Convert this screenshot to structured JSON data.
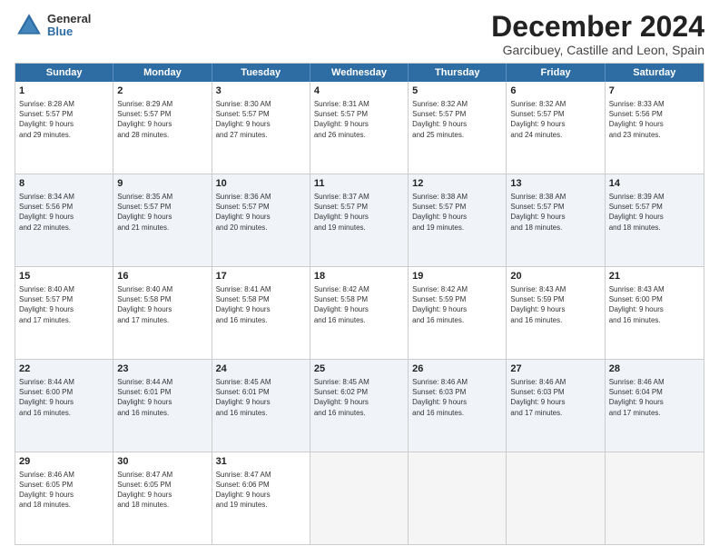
{
  "logo": {
    "general": "General",
    "blue": "Blue"
  },
  "title": {
    "month": "December 2024",
    "location": "Garcibuey, Castille and Leon, Spain"
  },
  "weekdays": [
    "Sunday",
    "Monday",
    "Tuesday",
    "Wednesday",
    "Thursday",
    "Friday",
    "Saturday"
  ],
  "rows": [
    {
      "alt": false,
      "cells": [
        {
          "day": "1",
          "lines": [
            "Sunrise: 8:28 AM",
            "Sunset: 5:57 PM",
            "Daylight: 9 hours",
            "and 29 minutes."
          ]
        },
        {
          "day": "2",
          "lines": [
            "Sunrise: 8:29 AM",
            "Sunset: 5:57 PM",
            "Daylight: 9 hours",
            "and 28 minutes."
          ]
        },
        {
          "day": "3",
          "lines": [
            "Sunrise: 8:30 AM",
            "Sunset: 5:57 PM",
            "Daylight: 9 hours",
            "and 27 minutes."
          ]
        },
        {
          "day": "4",
          "lines": [
            "Sunrise: 8:31 AM",
            "Sunset: 5:57 PM",
            "Daylight: 9 hours",
            "and 26 minutes."
          ]
        },
        {
          "day": "5",
          "lines": [
            "Sunrise: 8:32 AM",
            "Sunset: 5:57 PM",
            "Daylight: 9 hours",
            "and 25 minutes."
          ]
        },
        {
          "day": "6",
          "lines": [
            "Sunrise: 8:32 AM",
            "Sunset: 5:57 PM",
            "Daylight: 9 hours",
            "and 24 minutes."
          ]
        },
        {
          "day": "7",
          "lines": [
            "Sunrise: 8:33 AM",
            "Sunset: 5:56 PM",
            "Daylight: 9 hours",
            "and 23 minutes."
          ]
        }
      ]
    },
    {
      "alt": true,
      "cells": [
        {
          "day": "8",
          "lines": [
            "Sunrise: 8:34 AM",
            "Sunset: 5:56 PM",
            "Daylight: 9 hours",
            "and 22 minutes."
          ]
        },
        {
          "day": "9",
          "lines": [
            "Sunrise: 8:35 AM",
            "Sunset: 5:57 PM",
            "Daylight: 9 hours",
            "and 21 minutes."
          ]
        },
        {
          "day": "10",
          "lines": [
            "Sunrise: 8:36 AM",
            "Sunset: 5:57 PM",
            "Daylight: 9 hours",
            "and 20 minutes."
          ]
        },
        {
          "day": "11",
          "lines": [
            "Sunrise: 8:37 AM",
            "Sunset: 5:57 PM",
            "Daylight: 9 hours",
            "and 19 minutes."
          ]
        },
        {
          "day": "12",
          "lines": [
            "Sunrise: 8:38 AM",
            "Sunset: 5:57 PM",
            "Daylight: 9 hours",
            "and 19 minutes."
          ]
        },
        {
          "day": "13",
          "lines": [
            "Sunrise: 8:38 AM",
            "Sunset: 5:57 PM",
            "Daylight: 9 hours",
            "and 18 minutes."
          ]
        },
        {
          "day": "14",
          "lines": [
            "Sunrise: 8:39 AM",
            "Sunset: 5:57 PM",
            "Daylight: 9 hours",
            "and 18 minutes."
          ]
        }
      ]
    },
    {
      "alt": false,
      "cells": [
        {
          "day": "15",
          "lines": [
            "Sunrise: 8:40 AM",
            "Sunset: 5:57 PM",
            "Daylight: 9 hours",
            "and 17 minutes."
          ]
        },
        {
          "day": "16",
          "lines": [
            "Sunrise: 8:40 AM",
            "Sunset: 5:58 PM",
            "Daylight: 9 hours",
            "and 17 minutes."
          ]
        },
        {
          "day": "17",
          "lines": [
            "Sunrise: 8:41 AM",
            "Sunset: 5:58 PM",
            "Daylight: 9 hours",
            "and 16 minutes."
          ]
        },
        {
          "day": "18",
          "lines": [
            "Sunrise: 8:42 AM",
            "Sunset: 5:58 PM",
            "Daylight: 9 hours",
            "and 16 minutes."
          ]
        },
        {
          "day": "19",
          "lines": [
            "Sunrise: 8:42 AM",
            "Sunset: 5:59 PM",
            "Daylight: 9 hours",
            "and 16 minutes."
          ]
        },
        {
          "day": "20",
          "lines": [
            "Sunrise: 8:43 AM",
            "Sunset: 5:59 PM",
            "Daylight: 9 hours",
            "and 16 minutes."
          ]
        },
        {
          "day": "21",
          "lines": [
            "Sunrise: 8:43 AM",
            "Sunset: 6:00 PM",
            "Daylight: 9 hours",
            "and 16 minutes."
          ]
        }
      ]
    },
    {
      "alt": true,
      "cells": [
        {
          "day": "22",
          "lines": [
            "Sunrise: 8:44 AM",
            "Sunset: 6:00 PM",
            "Daylight: 9 hours",
            "and 16 minutes."
          ]
        },
        {
          "day": "23",
          "lines": [
            "Sunrise: 8:44 AM",
            "Sunset: 6:01 PM",
            "Daylight: 9 hours",
            "and 16 minutes."
          ]
        },
        {
          "day": "24",
          "lines": [
            "Sunrise: 8:45 AM",
            "Sunset: 6:01 PM",
            "Daylight: 9 hours",
            "and 16 minutes."
          ]
        },
        {
          "day": "25",
          "lines": [
            "Sunrise: 8:45 AM",
            "Sunset: 6:02 PM",
            "Daylight: 9 hours",
            "and 16 minutes."
          ]
        },
        {
          "day": "26",
          "lines": [
            "Sunrise: 8:46 AM",
            "Sunset: 6:03 PM",
            "Daylight: 9 hours",
            "and 16 minutes."
          ]
        },
        {
          "day": "27",
          "lines": [
            "Sunrise: 8:46 AM",
            "Sunset: 6:03 PM",
            "Daylight: 9 hours",
            "and 17 minutes."
          ]
        },
        {
          "day": "28",
          "lines": [
            "Sunrise: 8:46 AM",
            "Sunset: 6:04 PM",
            "Daylight: 9 hours",
            "and 17 minutes."
          ]
        }
      ]
    },
    {
      "alt": false,
      "cells": [
        {
          "day": "29",
          "lines": [
            "Sunrise: 8:46 AM",
            "Sunset: 6:05 PM",
            "Daylight: 9 hours",
            "and 18 minutes."
          ]
        },
        {
          "day": "30",
          "lines": [
            "Sunrise: 8:47 AM",
            "Sunset: 6:05 PM",
            "Daylight: 9 hours",
            "and 18 minutes."
          ]
        },
        {
          "day": "31",
          "lines": [
            "Sunrise: 8:47 AM",
            "Sunset: 6:06 PM",
            "Daylight: 9 hours",
            "and 19 minutes."
          ]
        },
        {
          "day": "",
          "lines": []
        },
        {
          "day": "",
          "lines": []
        },
        {
          "day": "",
          "lines": []
        },
        {
          "day": "",
          "lines": []
        }
      ]
    }
  ]
}
